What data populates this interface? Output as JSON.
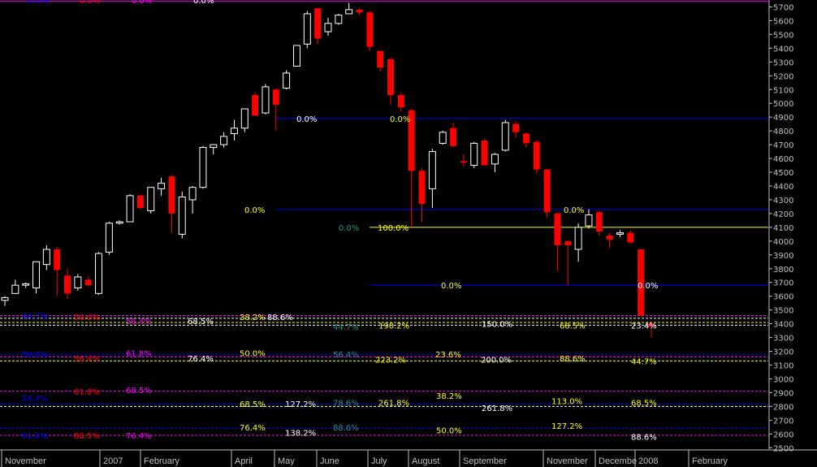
{
  "chart_data": {
    "type": "candlestick",
    "title": "",
    "xlabel": "",
    "ylabel": "",
    "ylim": [
      2490,
      5750
    ],
    "grid": false,
    "colors": {
      "background": "#000000",
      "up_candle": "#ffffff",
      "down_candle": "#ff0000",
      "axis": "#c0c0c0",
      "blue_line": "#0000ff",
      "magenta_line": "#ff00ff",
      "yellow_line": "#ffff00"
    },
    "y_ticks": [
      "2500",
      "2600",
      "2700",
      "2800",
      "2900",
      "3000",
      "3100",
      "3200",
      "3300",
      "3400",
      "3500",
      "3600",
      "3700",
      "3800",
      "3900",
      "4000",
      "4100",
      "4200",
      "4300",
      "4400",
      "4500",
      "4600",
      "4700",
      "4800",
      "4900",
      "5000",
      "5100",
      "5200",
      "5300",
      "5400",
      "5500",
      "5600",
      "5700"
    ],
    "x_labels": [
      "November",
      "2007",
      "February",
      "April",
      "May",
      "June",
      "July",
      "August",
      "September",
      "November",
      "Decembe",
      "2008",
      "February"
    ],
    "candles": [
      {
        "o": 3570,
        "h": 3600,
        "l": 3530,
        "c": 3590
      },
      {
        "o": 3620,
        "h": 3720,
        "l": 3620,
        "c": 3680
      },
      {
        "o": 3680,
        "h": 3700,
        "l": 3660,
        "c": 3690
      },
      {
        "o": 3660,
        "h": 3850,
        "l": 3620,
        "c": 3850
      },
      {
        "o": 3830,
        "h": 3970,
        "l": 3790,
        "c": 3940
      },
      {
        "o": 3940,
        "h": 3960,
        "l": 3600,
        "c": 3790
      },
      {
        "o": 3750,
        "h": 3800,
        "l": 3580,
        "c": 3620
      },
      {
        "o": 3660,
        "h": 3760,
        "l": 3640,
        "c": 3740
      },
      {
        "o": 3720,
        "h": 3740,
        "l": 3670,
        "c": 3680
      },
      {
        "o": 3620,
        "h": 3920,
        "l": 3610,
        "c": 3910
      },
      {
        "o": 3920,
        "h": 4140,
        "l": 3900,
        "c": 4130
      },
      {
        "o": 4130,
        "h": 4150,
        "l": 4120,
        "c": 4140
      },
      {
        "o": 4140,
        "h": 4340,
        "l": 4140,
        "c": 4330
      },
      {
        "o": 4330,
        "h": 4340,
        "l": 4230,
        "c": 4240
      },
      {
        "o": 4220,
        "h": 4390,
        "l": 4200,
        "c": 4390
      },
      {
        "o": 4380,
        "h": 4460,
        "l": 4330,
        "c": 4420
      },
      {
        "o": 4470,
        "h": 4480,
        "l": 4060,
        "c": 4200
      },
      {
        "o": 4050,
        "h": 4360,
        "l": 4020,
        "c": 4320
      },
      {
        "o": 4300,
        "h": 4400,
        "l": 4200,
        "c": 4390
      },
      {
        "o": 4390,
        "h": 4690,
        "l": 4380,
        "c": 4680
      },
      {
        "o": 4680,
        "h": 4700,
        "l": 4630,
        "c": 4700
      },
      {
        "o": 4700,
        "h": 4790,
        "l": 4680,
        "c": 4760
      },
      {
        "o": 4780,
        "h": 4880,
        "l": 4730,
        "c": 4820
      },
      {
        "o": 4820,
        "h": 4960,
        "l": 4790,
        "c": 4960
      },
      {
        "o": 5060,
        "h": 5080,
        "l": 4910,
        "c": 4910
      },
      {
        "o": 4930,
        "h": 5140,
        "l": 4920,
        "c": 5120
      },
      {
        "o": 5100,
        "h": 5110,
        "l": 4800,
        "c": 4990
      },
      {
        "o": 5110,
        "h": 5240,
        "l": 5100,
        "c": 5220
      },
      {
        "o": 5270,
        "h": 5420,
        "l": 5270,
        "c": 5420
      },
      {
        "o": 5430,
        "h": 5670,
        "l": 5400,
        "c": 5650
      },
      {
        "o": 5690,
        "h": 5690,
        "l": 5430,
        "c": 5470
      },
      {
        "o": 5520,
        "h": 5620,
        "l": 5490,
        "c": 5580
      },
      {
        "o": 5580,
        "h": 5650,
        "l": 5570,
        "c": 5640
      },
      {
        "o": 5650,
        "h": 5730,
        "l": 5650,
        "c": 5680
      },
      {
        "o": 5680,
        "h": 5690,
        "l": 5640,
        "c": 5660
      },
      {
        "o": 5660,
        "h": 5670,
        "l": 5380,
        "c": 5410
      },
      {
        "o": 5380,
        "h": 5380,
        "l": 5230,
        "c": 5260
      },
      {
        "o": 5320,
        "h": 5330,
        "l": 4990,
        "c": 5060
      },
      {
        "o": 5060,
        "h": 5080,
        "l": 4940,
        "c": 4970
      },
      {
        "o": 4950,
        "h": 4960,
        "l": 4110,
        "c": 4510
      },
      {
        "o": 4510,
        "h": 4530,
        "l": 4140,
        "c": 4270
      },
      {
        "o": 4380,
        "h": 4670,
        "l": 4240,
        "c": 4650
      },
      {
        "o": 4710,
        "h": 4800,
        "l": 4700,
        "c": 4790
      },
      {
        "o": 4820,
        "h": 4860,
        "l": 4680,
        "c": 4690
      },
      {
        "o": 4580,
        "h": 4630,
        "l": 4540,
        "c": 4570
      },
      {
        "o": 4550,
        "h": 4720,
        "l": 4530,
        "c": 4710
      },
      {
        "o": 4730,
        "h": 4740,
        "l": 4550,
        "c": 4550
      },
      {
        "o": 4560,
        "h": 4640,
        "l": 4500,
        "c": 4630
      },
      {
        "o": 4660,
        "h": 4880,
        "l": 4650,
        "c": 4860
      },
      {
        "o": 4850,
        "h": 4870,
        "l": 4750,
        "c": 4790
      },
      {
        "o": 4780,
        "h": 4790,
        "l": 4680,
        "c": 4710
      },
      {
        "o": 4720,
        "h": 4730,
        "l": 4490,
        "c": 4520
      },
      {
        "o": 4520,
        "h": 4520,
        "l": 4170,
        "c": 4210
      },
      {
        "o": 4200,
        "h": 4210,
        "l": 3780,
        "c": 3970
      },
      {
        "o": 4000,
        "h": 4000,
        "l": 3680,
        "c": 3970
      },
      {
        "o": 3940,
        "h": 4130,
        "l": 3850,
        "c": 4100
      },
      {
        "o": 4110,
        "h": 4230,
        "l": 4090,
        "c": 4190
      },
      {
        "o": 4210,
        "h": 4220,
        "l": 4040,
        "c": 4070
      },
      {
        "o": 4040,
        "h": 4060,
        "l": 3950,
        "c": 4010
      },
      {
        "o": 4050,
        "h": 4080,
        "l": 4030,
        "c": 4060
      },
      {
        "o": 4060,
        "h": 4080,
        "l": 3980,
        "c": 3990
      },
      {
        "o": 3940,
        "h": 3940,
        "l": 3450,
        "c": 3460
      },
      {
        "o": 3400,
        "h": 3420,
        "l": 3300,
        "c": 3380
      }
    ],
    "fib_lines": [
      {
        "y": 5740,
        "x_from": "left",
        "color": "#ff00ff",
        "dash": false
      },
      {
        "y": 4890,
        "x_from": "mid",
        "color": "#0000ff",
        "dash": false
      },
      {
        "y": 4230,
        "x_from": "mid",
        "color": "#0000ff",
        "dash": false
      },
      {
        "y": 4100,
        "x_from": "right",
        "color": "#ffff00",
        "dash": false
      },
      {
        "y": 3680,
        "x_from": "right",
        "color": "#0000ff",
        "dash": false
      },
      {
        "y": 3460,
        "x_from": "left",
        "color": "#ff00ff",
        "dash": true
      },
      {
        "y": 3440,
        "x_from": "left",
        "color": "#ffffff",
        "dash": true
      },
      {
        "y": 3410,
        "x_from": "left",
        "color": "#ffff00",
        "dash": true
      },
      {
        "y": 3390,
        "x_from": "left",
        "color": "#ffffff",
        "dash": true
      },
      {
        "y": 3180,
        "x_from": "left",
        "color": "#0000ff",
        "dash": true
      },
      {
        "y": 3160,
        "x_from": "left",
        "color": "#ff00ff",
        "dash": true
      },
      {
        "y": 3130,
        "x_from": "left",
        "color": "#ffff00",
        "dash": true
      },
      {
        "y": 2910,
        "x_from": "left",
        "color": "#ff00ff",
        "dash": true
      },
      {
        "y": 2820,
        "x_from": "left",
        "color": "#0000ff",
        "dash": true
      },
      {
        "y": 2800,
        "x_from": "left",
        "color": "#ffffff",
        "dash": true
      },
      {
        "y": 2640,
        "x_from": "left",
        "color": "#0000ff",
        "dash": true
      },
      {
        "y": 2590,
        "x_from": "left",
        "color": "#ff00ff",
        "dash": true
      }
    ],
    "labels": [
      {
        "text": "0.0%",
        "color": "#0000ff",
        "y": 5750
      },
      {
        "text": "0.0%",
        "color": "#ff0000",
        "y": 5750
      },
      {
        "text": "0.0%",
        "color": "#ff00ff",
        "y": 5750
      },
      {
        "text": "0.0%",
        "color": "#ffffff",
        "y": 5750
      },
      {
        "text": "0.0%",
        "color": "#ffffff",
        "y": 4890
      },
      {
        "text": "0.0%",
        "color": "#ffff00",
        "y": 4890
      },
      {
        "text": "0.0%",
        "color": "#ffff00",
        "y": 4230
      },
      {
        "text": "0.0%",
        "color": "#ffff00",
        "y": 4230
      },
      {
        "text": "0.0%",
        "color": "#2f8f8f",
        "y": 4100
      },
      {
        "text": "100.0%",
        "color": "#ffff00",
        "y": 4100
      },
      {
        "text": "0.0%",
        "color": "#ffff00",
        "y": 3680
      },
      {
        "text": "0.0%",
        "color": "#ffffff",
        "y": 3680
      },
      {
        "text": "44.7%",
        "color": "#0000ff",
        "y": 3460
      },
      {
        "text": "50.0%",
        "color": "#ff0000",
        "y": 3450
      },
      {
        "text": "56.4%",
        "color": "#ff00ff",
        "y": 3420
      },
      {
        "text": "68.5%",
        "color": "#ffffff",
        "y": 3420
      },
      {
        "text": "38.2%",
        "color": "#ffff00",
        "y": 3450
      },
      {
        "text": "88.6%",
        "color": "#ffffff",
        "y": 3450
      },
      {
        "text": "44.7%",
        "color": "#2f8f8f",
        "y": 3380
      },
      {
        "text": "190.2%",
        "color": "#ffff00",
        "y": 3390
      },
      {
        "text": "150.0%",
        "color": "#ffffff",
        "y": 3400
      },
      {
        "text": "68.5%",
        "color": "#ffff00",
        "y": 3390
      },
      {
        "text": "23.4%",
        "color": "#ffffff",
        "y": 3390
      },
      {
        "text": "50.0%",
        "color": "#0000ff",
        "y": 3180
      },
      {
        "text": "61.8%",
        "color": "#ff00ff",
        "y": 3190
      },
      {
        "text": "50.0%",
        "color": "#ffff00",
        "y": 3190
      },
      {
        "text": "56.4%",
        "color": "#2f8f8f",
        "y": 3180
      },
      {
        "text": "23.6%",
        "color": "#ffff00",
        "y": 3180
      },
      {
        "text": "56.4%",
        "color": "#ff0000",
        "y": 3150
      },
      {
        "text": "76.4%",
        "color": "#ffffff",
        "y": 3150
      },
      {
        "text": "223.2%",
        "color": "#ffff00",
        "y": 3140
      },
      {
        "text": "200.0%",
        "color": "#ffffff",
        "y": 3140
      },
      {
        "text": "88.6%",
        "color": "#ffff00",
        "y": 3150
      },
      {
        "text": "44.7%",
        "color": "#ffff00",
        "y": 3130
      },
      {
        "text": "61.8%",
        "color": "#ff0000",
        "y": 2910
      },
      {
        "text": "68.5%",
        "color": "#ff00ff",
        "y": 2920
      },
      {
        "text": "38.2%",
        "color": "#ffff00",
        "y": 2880
      },
      {
        "text": "56.4%",
        "color": "#0000ff",
        "y": 2860
      },
      {
        "text": "68.5%",
        "color": "#ffff00",
        "y": 2820
      },
      {
        "text": "127.2%",
        "color": "#ffffff",
        "y": 2820
      },
      {
        "text": "78.6%",
        "color": "#2f8f8f",
        "y": 2830
      },
      {
        "text": "261.8%",
        "color": "#ffff00",
        "y": 2830
      },
      {
        "text": "261.8%",
        "color": "#ffffff",
        "y": 2790
      },
      {
        "text": "113.0%",
        "color": "#ffff00",
        "y": 2840
      },
      {
        "text": "68.5%",
        "color": "#ffff00",
        "y": 2830
      },
      {
        "text": "76.4%",
        "color": "#ffff00",
        "y": 2650
      },
      {
        "text": "138.2%",
        "color": "#ffffff",
        "y": 2610
      },
      {
        "text": "88.6%",
        "color": "#2f8f8f",
        "y": 2650
      },
      {
        "text": "50.0%",
        "color": "#ffff00",
        "y": 2630
      },
      {
        "text": "127.2%",
        "color": "#ffff00",
        "y": 2660
      },
      {
        "text": "88.6%",
        "color": "#ffffff",
        "y": 2580
      },
      {
        "text": "61.8%",
        "color": "#0000ff",
        "y": 2590
      },
      {
        "text": "88.5%",
        "color": "#ff0000",
        "y": 2590
      },
      {
        "text": "76.4%",
        "color": "#ff00ff",
        "y": 2590
      }
    ]
  }
}
